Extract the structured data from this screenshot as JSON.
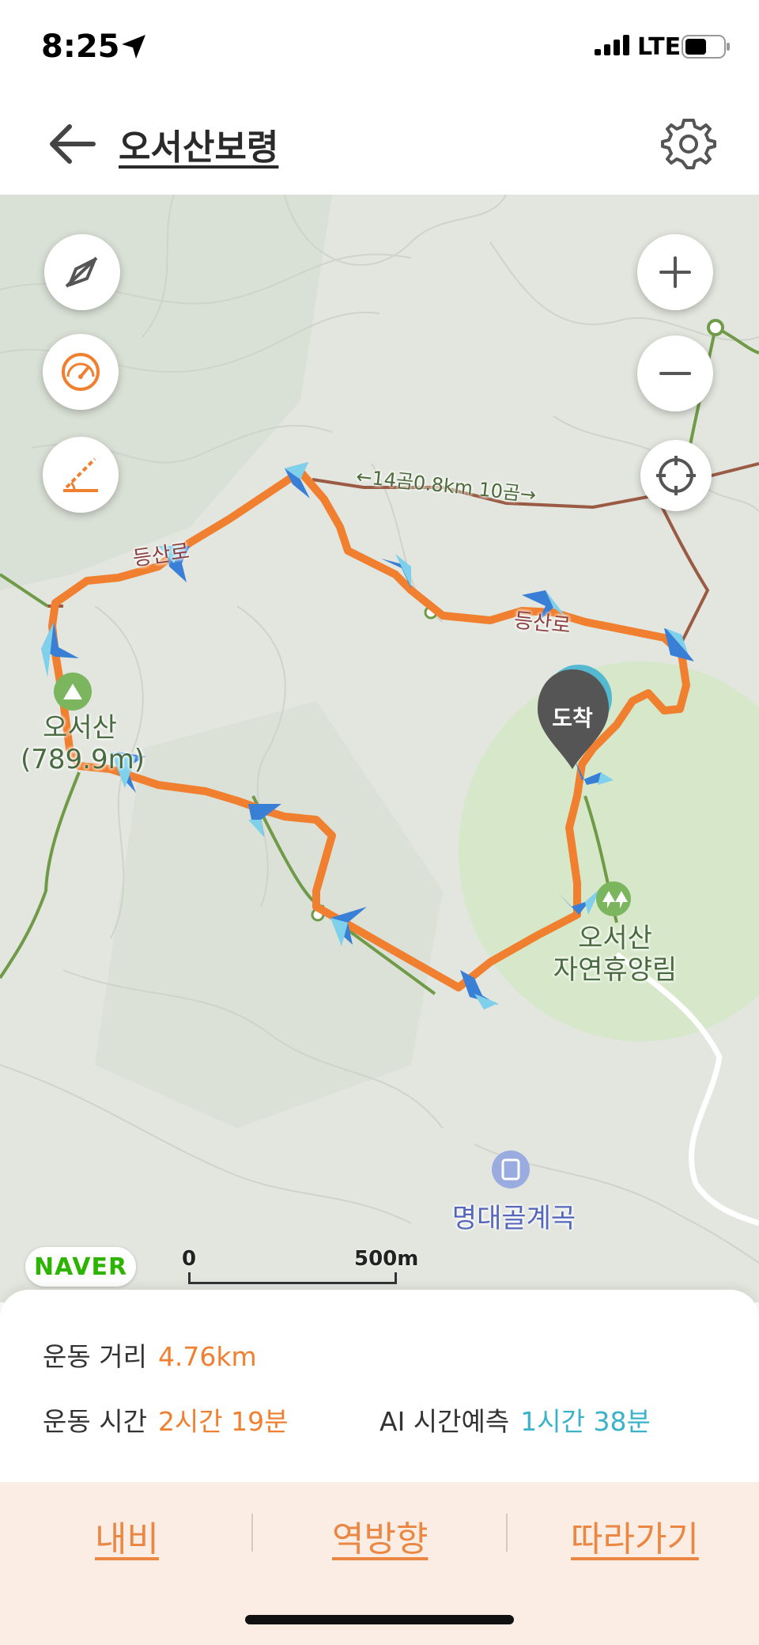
{
  "status_bar": {
    "time": "8:25",
    "network": "LTE"
  },
  "header": {
    "title": "오서산보령"
  },
  "map": {
    "labels": {
      "peak": "오서산\n(789.9m)",
      "forest": "오서산\n자연휴양림",
      "valley": "명대골계곡",
      "trail_distance": "←14곰0.8km 10곰→",
      "trail_top": "등산로",
      "trail_right": "등산로"
    },
    "arrival_marker": "도착",
    "naver_logo": "NAVER",
    "scale": {
      "start": "0",
      "end": "500m"
    }
  },
  "stats": {
    "distance_label": "운동 거리",
    "distance_value": "4.76km",
    "time_label": "운동 시간",
    "time_value": "2시간 19분",
    "ai_label": "AI 시간예측",
    "ai_value": "1시간 38분"
  },
  "actions": {
    "navi": "내비",
    "reverse": "역방향",
    "follow": "따라가기"
  },
  "colors": {
    "route": "#f07f2f",
    "accent_blue": "#3ab2c9",
    "naver_green": "#2db400",
    "action_bg": "#fbede4"
  }
}
